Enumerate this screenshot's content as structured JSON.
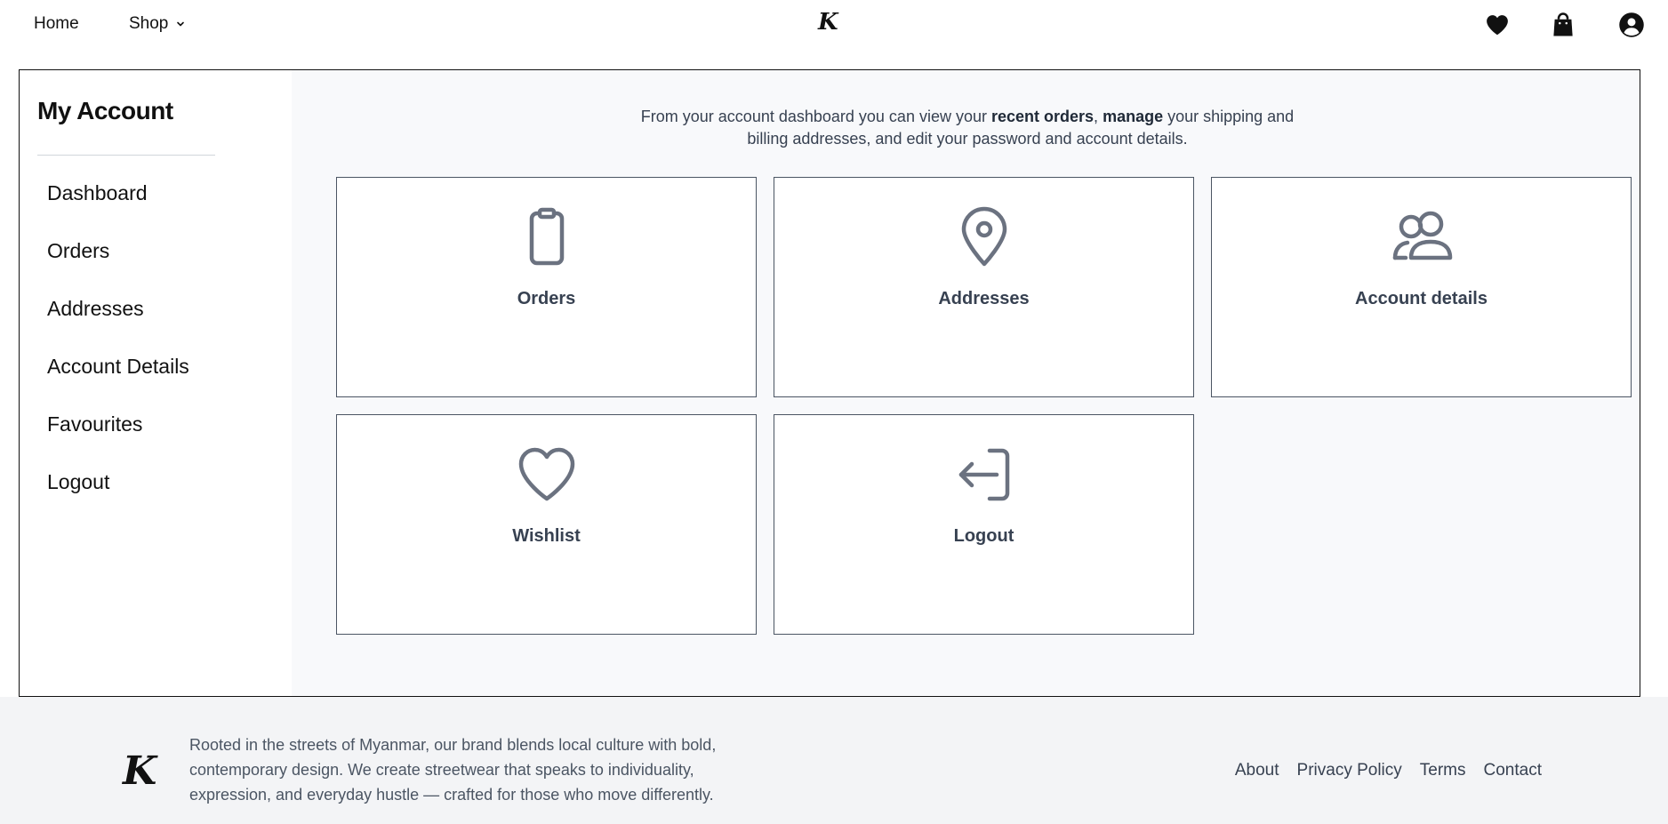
{
  "header": {
    "nav": {
      "home": "Home",
      "shop": "Shop"
    },
    "logo": "K",
    "icons": [
      "heart-icon",
      "shopping-bag-icon",
      "user-circle-icon"
    ]
  },
  "sidebar": {
    "title": "My Account",
    "items": [
      {
        "label": "Dashboard"
      },
      {
        "label": "Orders"
      },
      {
        "label": "Addresses"
      },
      {
        "label": "Account Details"
      },
      {
        "label": "Favourites"
      },
      {
        "label": "Logout"
      }
    ]
  },
  "main": {
    "intro": {
      "part1": "From your account dashboard you can view your ",
      "bold1": "recent orders",
      "part2": ", ",
      "bold2": "manage",
      "part3": " your shipping and billing addresses, and edit your password and account details."
    },
    "cards": [
      {
        "label": "Orders",
        "icon": "clipboard-icon"
      },
      {
        "label": "Addresses",
        "icon": "map-pin-icon"
      },
      {
        "label": "Account details",
        "icon": "users-icon"
      },
      {
        "label": "Wishlist",
        "icon": "heart-outline-icon"
      },
      {
        "label": "Logout",
        "icon": "logout-icon"
      }
    ]
  },
  "footer": {
    "logo": "K",
    "text": "Rooted in the streets of Myanmar, our brand blends local culture with bold, contemporary design. We create streetwear that speaks to individuality, expression, and everyday hustle — crafted for those who move differently.",
    "links": [
      "About",
      "Privacy Policy",
      "Terms",
      "Contact"
    ]
  },
  "colors": {
    "border": "#111111",
    "card_border": "#4b5563",
    "icon_stroke": "#6b7280",
    "content_bg": "#f8f9fb",
    "footer_bg": "#f3f4f6"
  }
}
